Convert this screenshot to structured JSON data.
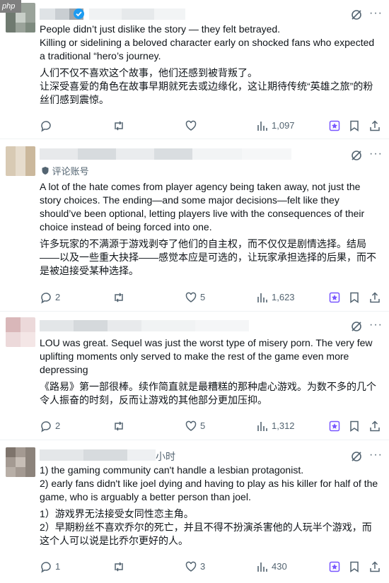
{
  "watermark": "php",
  "posts": [
    {
      "text_en": "People didn’t just dislike the story — they felt betrayed.\nKilling or sidelining a beloved character early on shocked fans who expected a traditional “hero’s journey.",
      "text_zh": "人们不仅不喜欢这个故事，他们还感到被背叛了。\n让深受喜爱的角色在故事早期就死去或边缘化，这让期待传统“英雄之旅”的粉丝们感到震惊。",
      "replies": "",
      "reposts": "",
      "likes": "",
      "views": "1,097"
    },
    {
      "badge": "评论账号",
      "text_en": "A lot of the hate comes from player agency being taken away, not just the story choices. The ending—and some major decisions—felt like they should’ve been optional, letting players live with the consequences of their choice instead of being forced into one.",
      "text_zh": "许多玩家的不满源于游戏剥夺了他们的自主权，而不仅仅是剧情选择。结局——以及一些重大抉择——感觉本应是可选的，让玩家承担选择的后果，而不是被迫接受某种选择。",
      "replies": "2",
      "reposts": "",
      "likes": "5",
      "views": "1,623"
    },
    {
      "text_en": "LOU was great. Sequel was just the worst type of misery porn. The very few uplifting moments only served to make the rest of the game even more depressing",
      "text_zh": "《路易》第一部很棒。续作简直就是最糟糕的那种虐心游戏。为数不多的几个令人振奋的时刻，反而让游戏的其他部分更加压抑。",
      "replies": "2",
      "reposts": "",
      "likes": "5",
      "views": "1,312"
    },
    {
      "time_suffix": "小时",
      "text_en": "1) the gaming community can't handle a lesbian protagonist.\n2) early fans didn't like joel dying and having to play as his killer for half of the game, who is arguably a better person than joel.",
      "text_zh": "1）游戏界无法接受女同性恋主角。\n2）早期粉丝不喜欢乔尔的死亡，并且不得不扮演杀害他的人玩半个游戏，而这个人可以说是比乔尔更好的人。",
      "replies": "1",
      "reposts": "",
      "likes": "3",
      "views": "430"
    }
  ]
}
